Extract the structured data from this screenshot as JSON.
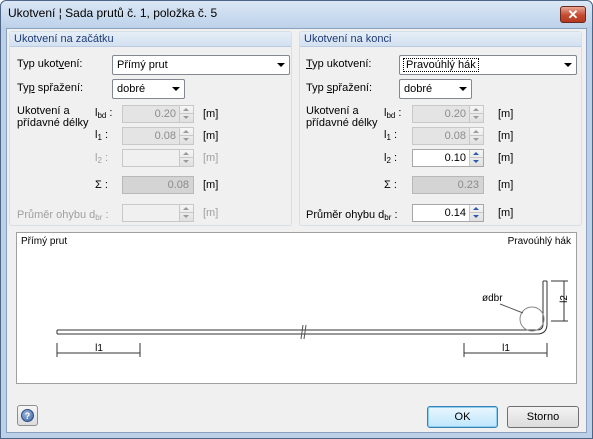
{
  "window": {
    "title": "Ukotvení ¦ Sada prutů č. 1, položka č. 5",
    "close_glyph": "✕"
  },
  "start": {
    "title": "Ukotvení na začátku",
    "type_label_pre": "Typ ukot",
    "type_label_ul": "v",
    "type_label_post": "ení:",
    "type_value": "Přímý prut",
    "coupling_label_pre": "Ty",
    "coupling_label_ul": "p",
    "coupling_label_post": " spřažení:",
    "coupling_value": "dobré",
    "lengths_label_1": "Ukotvení a",
    "lengths_label_2": "přídavné délky",
    "lbd_sym": "l",
    "lbd_sub": "bd",
    "lbd_value": "0.20",
    "lbd_unit": "[m]",
    "l1_sym": "l",
    "l1_sub": "1",
    "l1_value": "0.08",
    "l1_unit": "[m]",
    "l2_sym": "l",
    "l2_sub": "2",
    "l2_value": "",
    "l2_unit": "[m]",
    "sum_sym": "Σ :",
    "sum_value": "0.08",
    "sum_unit": "[m]",
    "diam_label": "Průměr ohybu d",
    "diam_sub": "br",
    "diam_value": "",
    "diam_unit": "[m]"
  },
  "end": {
    "title": "Ukotvení na konci",
    "type_label_pre": "",
    "type_label_ul": "T",
    "type_label_post": "yp ukotvení:",
    "type_value": "Pravoúhlý hák",
    "coupling_label_pre": "Typ ",
    "coupling_label_ul": "s",
    "coupling_label_post": "přažení:",
    "coupling_value": "dobré",
    "lengths_label_1": "Ukotvení a",
    "lengths_label_2": "přídavné délky",
    "lbd_sym": "l",
    "lbd_sub": "bd",
    "lbd_value": "0.20",
    "lbd_unit": "[m]",
    "l1_sym": "l",
    "l1_sub": "1",
    "l1_value": "0.08",
    "l1_unit": "[m]",
    "l2_sym": "l",
    "l2_sub": "2",
    "l2_value": "0.10",
    "l2_unit": "[m]",
    "sum_sym": "Σ :",
    "sum_value": "0.23",
    "sum_unit": "[m]",
    "diam_label": "Průměr ohybu d",
    "diam_sub": "br",
    "diam_value": "0.14",
    "diam_unit": "[m]"
  },
  "preview": {
    "left_caption": "Přímý prut",
    "right_caption": "Pravoúhlý hák",
    "dim_l1_left": "l1",
    "dim_l1_right": "l1",
    "dim_l2": "l2",
    "dim_diam": "ødbr"
  },
  "buttons": {
    "help_glyph": "?",
    "ok": "OK",
    "cancel": "Storno"
  },
  "colors": {
    "group_title_text": "#1e3b76",
    "disabled_field": "#d4d4d4"
  }
}
